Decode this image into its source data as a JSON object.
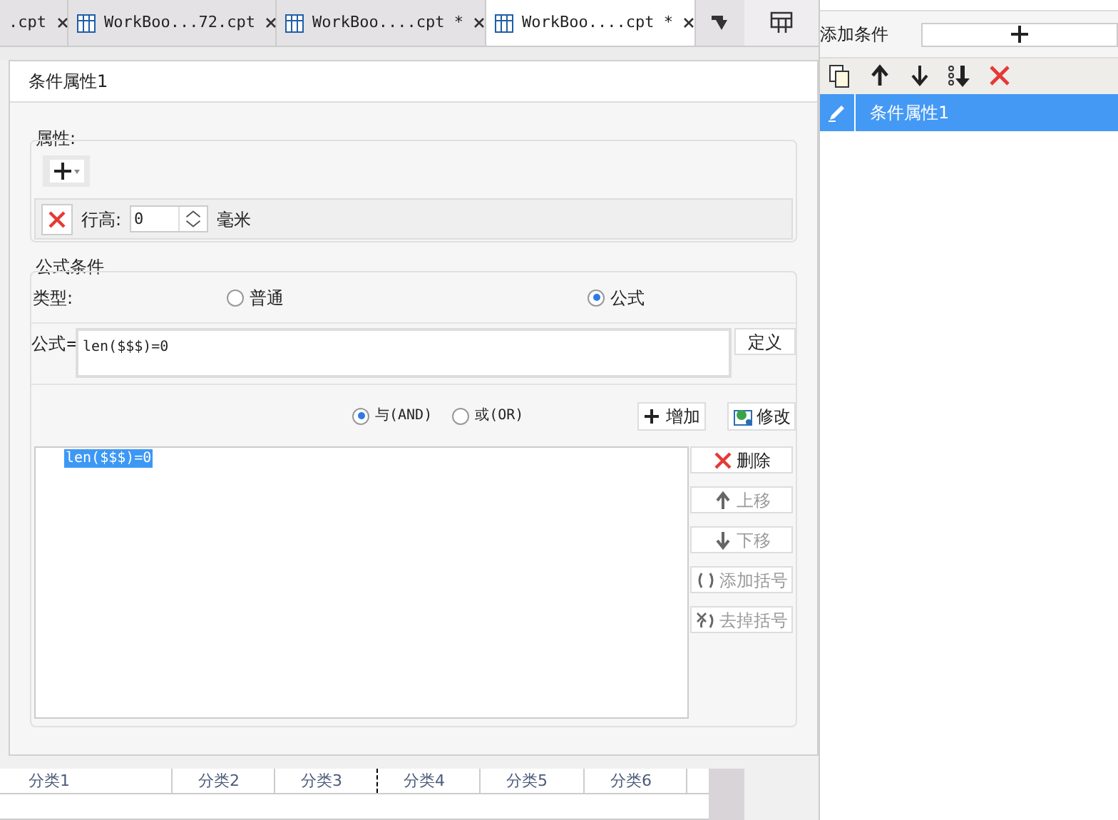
{
  "tabs": [
    {
      "label": ".cpt",
      "selected": false
    },
    {
      "label": "WorkBoo...72.cpt",
      "selected": false
    },
    {
      "label": "WorkBoo....cpt *",
      "selected": false
    },
    {
      "label": "WorkBoo....cpt *",
      "selected": true
    }
  ],
  "sheet": {
    "column_headers": [
      "分类1",
      "分类2",
      "分类3",
      "分类4",
      "分类5",
      "分类6"
    ]
  },
  "dialog": {
    "title": "条件属性1",
    "properties": {
      "legend": "属性:",
      "row_height": {
        "label": "行高:",
        "value": "0",
        "unit": "毫米"
      }
    },
    "formula_condition": {
      "legend": "公式条件",
      "type_label": "类型:",
      "types": [
        {
          "label": "普通",
          "selected": false
        },
        {
          "label": "公式",
          "selected": true
        }
      ],
      "formula_label": "公式=",
      "formula": "len($$$)=0",
      "define_button": "定义",
      "operators": [
        {
          "label": "与(AND)",
          "selected": true
        },
        {
          "label": "或(OR)",
          "selected": false
        }
      ],
      "add_button": "增加",
      "modify_button": "修改",
      "conditions": [
        {
          "text": "len($$$)=0",
          "selected": true
        }
      ],
      "side_buttons": [
        {
          "kind": "delete",
          "label": "删除",
          "disabled": false
        },
        {
          "kind": "up",
          "label": "上移",
          "disabled": true
        },
        {
          "kind": "down",
          "label": "下移",
          "disabled": true
        },
        {
          "kind": "add_paren",
          "label": "添加括号",
          "disabled": true
        },
        {
          "kind": "remove_paren",
          "label": "去掉括号",
          "disabled": true
        }
      ]
    }
  },
  "right_panel": {
    "add_label": "添加条件",
    "items": [
      {
        "label": "条件属性1",
        "selected": true
      }
    ]
  }
}
